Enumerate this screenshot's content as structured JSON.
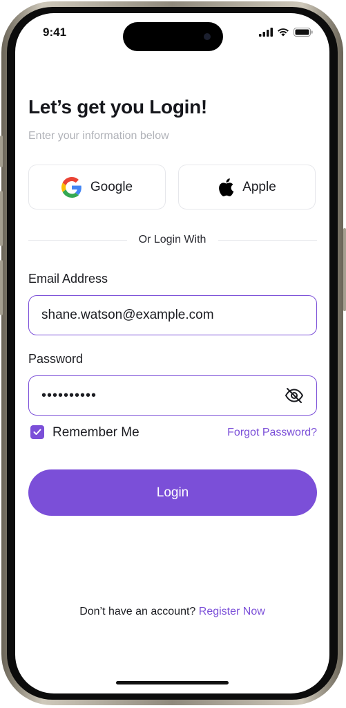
{
  "status_bar": {
    "time": "9:41"
  },
  "header": {
    "title": "Let’s get you Login!",
    "subtitle": "Enter your information below"
  },
  "social": {
    "google_label": "Google",
    "apple_label": "Apple"
  },
  "divider": {
    "text": "Or Login With"
  },
  "email": {
    "label": "Email Address",
    "value": "shane.watson@example.com"
  },
  "password": {
    "label": "Password",
    "masked_value": "••••••••••"
  },
  "remember": {
    "label": "Remember Me",
    "checked": true
  },
  "forgot_label": "Forgot Password?",
  "login_label": "Login",
  "register": {
    "prompt": "Don’t have an account?",
    "link": "Register Now"
  },
  "colors": {
    "accent": "#7b4fd8",
    "text": "#1c1d22",
    "muted": "#b0b2b8",
    "border": "#e6e7eb"
  }
}
